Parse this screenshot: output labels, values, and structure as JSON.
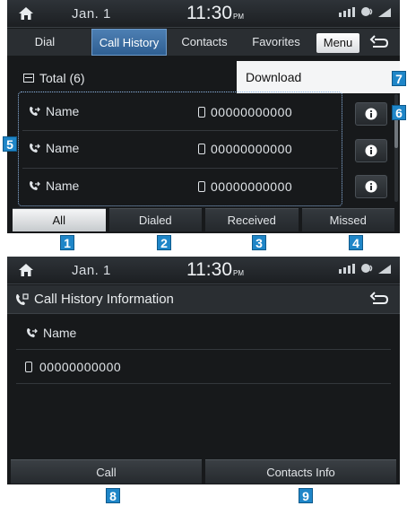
{
  "status": {
    "date": "Jan.  1",
    "time": "11:30",
    "ampm": "PM"
  },
  "screen1": {
    "tabs": [
      "Dial",
      "Call History",
      "Contacts",
      "Favorites"
    ],
    "active_tab": "Call History",
    "menu_label": "Menu",
    "total_label": "Total (6)",
    "dropdown_item": "Download",
    "rows": [
      {
        "name": "Name",
        "number": "00000000000"
      },
      {
        "name": "Name",
        "number": "00000000000"
      },
      {
        "name": "Name",
        "number": "00000000000"
      }
    ],
    "filters": [
      "All",
      "Dialed",
      "Received",
      "Missed"
    ],
    "active_filter": "All"
  },
  "screen2": {
    "title": "Call History Information",
    "name": "Name",
    "number": "00000000000",
    "buttons": [
      "Call",
      "Contacts Info"
    ]
  },
  "callouts": [
    "1",
    "2",
    "3",
    "4",
    "5",
    "6",
    "7",
    "8",
    "9"
  ],
  "colors": {
    "callout": "#1f86c8",
    "active_tab": "#3a6ea5",
    "screen_bg": "#17191b"
  }
}
